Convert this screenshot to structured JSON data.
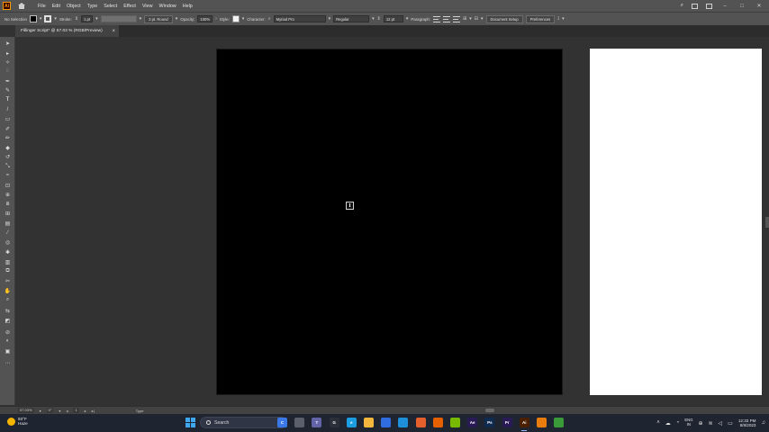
{
  "app": {
    "logo_text": "Ai",
    "menus": [
      "File",
      "Edit",
      "Object",
      "Type",
      "Select",
      "Effect",
      "View",
      "Window",
      "Help"
    ]
  },
  "control_bar": {
    "selection": "No Selection",
    "stroke_label": "Stroke:",
    "stroke_value": "1 pt",
    "brush_label": "3 pt. Round",
    "opacity_label": "Opacity:",
    "opacity_value": "100%",
    "style_label": "Style:",
    "character_label": "Character:",
    "font_family": "Myriad Pro",
    "font_style": "Regular",
    "font_size": "12 pt",
    "paragraph_label": "Paragraph:",
    "document_setup": "Document Setup",
    "preferences": "Preferences"
  },
  "document": {
    "tab_title": "Fillinger Script* @ 57.03 % (RGB/Preview)",
    "close_glyph": "×"
  },
  "status_bar": {
    "zoom": "57.03%",
    "rotation": "0°",
    "artboard_number": "1",
    "tool_name": "Type"
  },
  "taskbar": {
    "weather_temp": "93°F",
    "weather_desc": "Haze",
    "search_placeholder": "Search",
    "apps": [
      {
        "name": "copilot",
        "label": "C",
        "color": "#3b78e7"
      },
      {
        "name": "file-explorer-alt",
        "label": "",
        "color": "#5b5f6b"
      },
      {
        "name": "teams",
        "label": "T",
        "color": "#6264a7"
      },
      {
        "name": "chatgpt",
        "label": "G",
        "color": "#2a2f3a"
      },
      {
        "name": "edge",
        "label": "e",
        "color": "#1b9de2"
      },
      {
        "name": "file-explorer",
        "label": "",
        "color": "#f2b73c"
      },
      {
        "name": "store",
        "label": "",
        "color": "#2f6de0"
      },
      {
        "name": "mail",
        "label": "",
        "color": "#1e8fd9"
      },
      {
        "name": "app-orange",
        "label": "",
        "color": "#e55f2c"
      },
      {
        "name": "firefox",
        "label": "",
        "color": "#e66000"
      },
      {
        "name": "nvidia",
        "label": "",
        "color": "#76b900"
      },
      {
        "name": "after-effects",
        "label": "Ae",
        "color": "#2a1a55"
      },
      {
        "name": "photoshop",
        "label": "Ps",
        "color": "#0f2b4f"
      },
      {
        "name": "premiere",
        "label": "Pr",
        "color": "#2a1a55"
      },
      {
        "name": "illustrator",
        "label": "Ai",
        "color": "#4a2000"
      },
      {
        "name": "blender",
        "label": "",
        "color": "#e87d0d"
      },
      {
        "name": "chrome",
        "label": "",
        "color": "#3a9a3a"
      }
    ],
    "language_top": "ENG",
    "language_bottom": "IN",
    "time": "12:33 PM",
    "date": "8/8/2023"
  }
}
